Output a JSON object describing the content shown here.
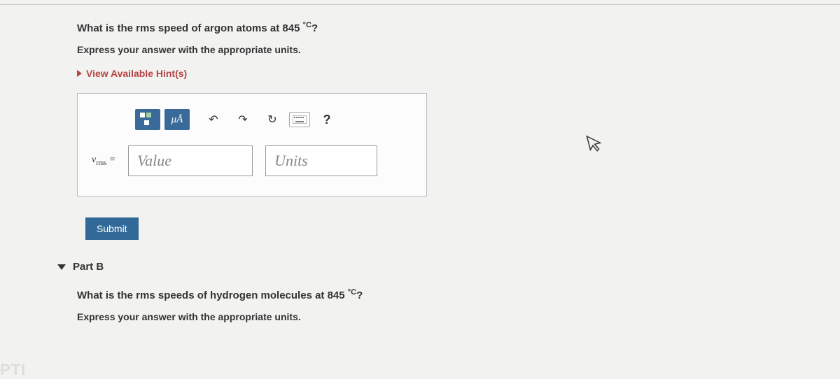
{
  "partA": {
    "question_prefix": "What is the rms speed of argon atoms at 845 ",
    "question_degree": "°C",
    "question_suffix": "?",
    "instruction": "Express your answer with the appropriate units.",
    "hints_label": "View Available Hint(s)"
  },
  "toolbar": {
    "mu_label": "μÅ",
    "undo_glyph": "↶",
    "redo_glyph": "↷",
    "reset_glyph": "↻",
    "keyboard_glyph": "⌨",
    "help_glyph": "?"
  },
  "input": {
    "var_symbol": "v",
    "var_subscript": "rms",
    "equals": " = ",
    "value_placeholder": "Value",
    "units_placeholder": "Units"
  },
  "actions": {
    "submit_label": "Submit"
  },
  "partB": {
    "header": "Part B",
    "question_prefix": "What is the rms speeds of hydrogen molecules at 845 ",
    "question_degree": "°C",
    "question_suffix": "?",
    "instruction": "Express your answer with the appropriate units."
  }
}
